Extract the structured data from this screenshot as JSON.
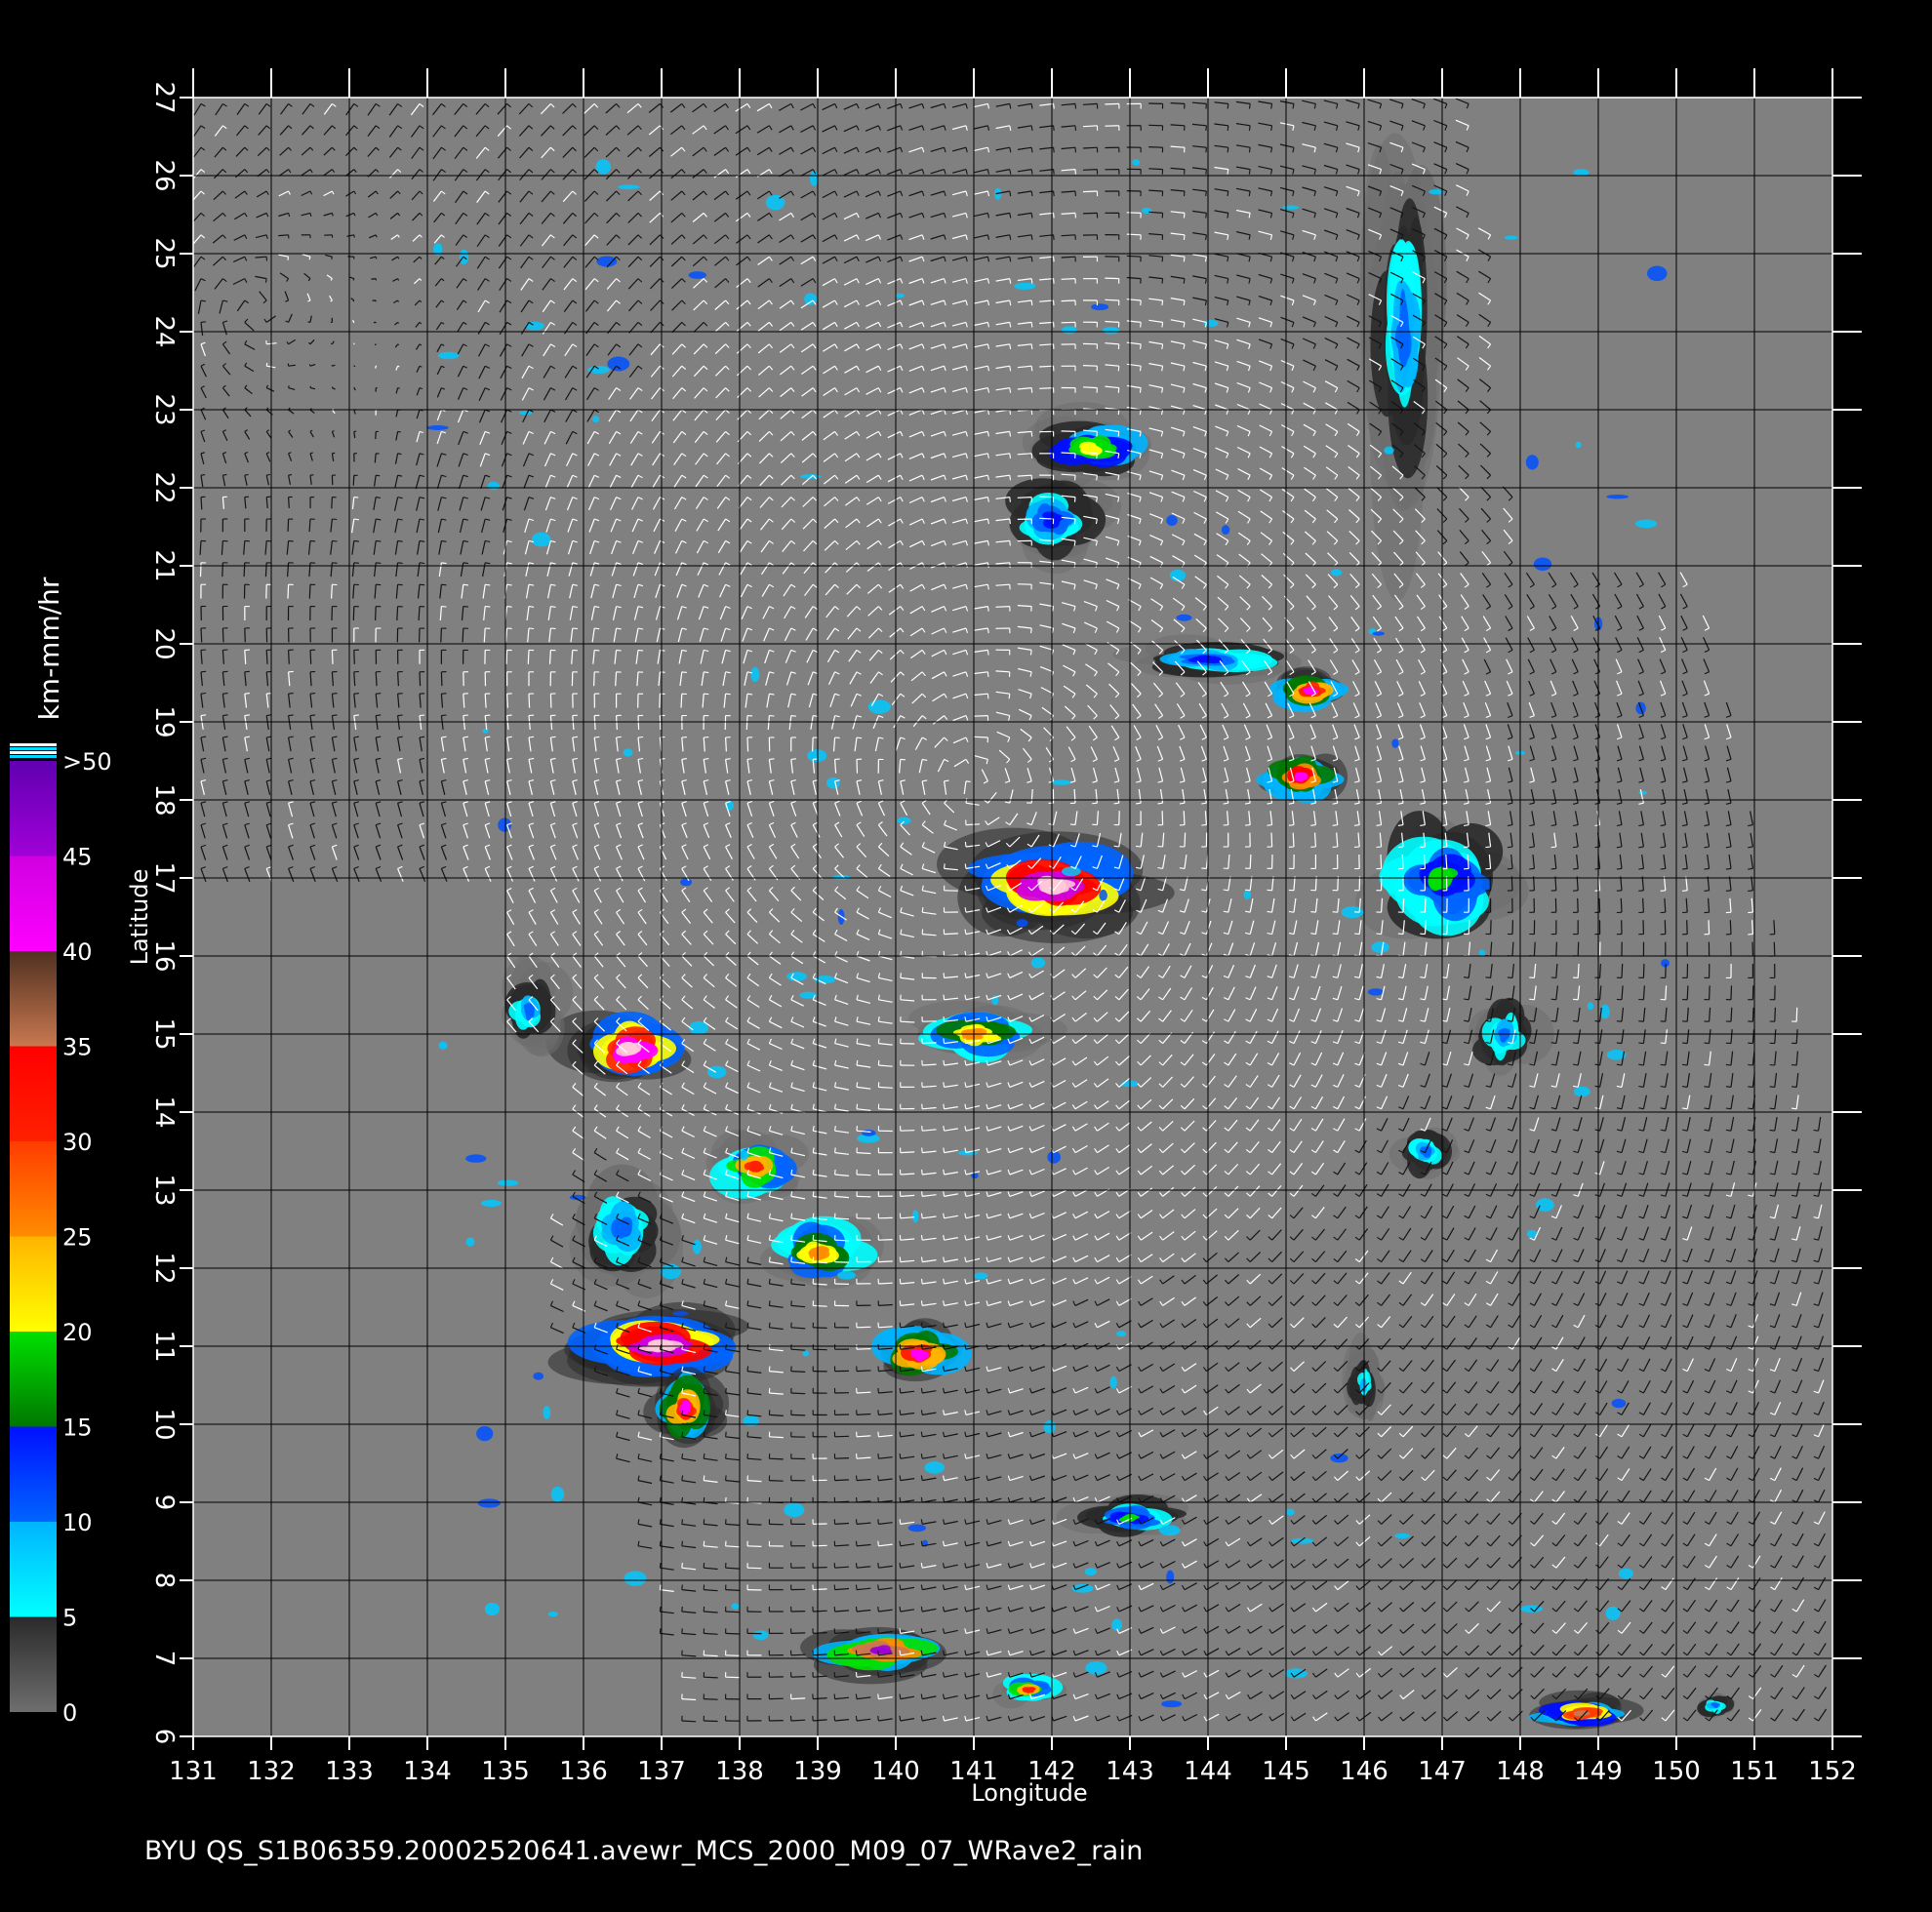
{
  "map": {
    "x_axis": {
      "label": "Longitude",
      "ticks": [
        "131",
        "132",
        "133",
        "134",
        "135",
        "136",
        "137",
        "138",
        "139",
        "140",
        "141",
        "142",
        "143",
        "144",
        "145",
        "146",
        "147",
        "148",
        "149",
        "150",
        "151",
        "152"
      ],
      "range": [
        131,
        152
      ]
    },
    "y_axis": {
      "label": "Latitude",
      "ticks": [
        "6",
        "7",
        "8",
        "9",
        "10",
        "11",
        "12",
        "13",
        "14",
        "15",
        "16",
        "17",
        "18",
        "19",
        "20",
        "21",
        "22",
        "23",
        "24",
        "25",
        "26",
        "27"
      ],
      "range": [
        6,
        27
      ]
    },
    "grid": true,
    "background_color": "#808080",
    "wind_vector_colors": {
      "light": "#ffffff",
      "dark": "#141414"
    },
    "cyclone_center": {
      "lon": 141.0,
      "lat": 18.2
    }
  },
  "colorbar": {
    "label": "km-mm/hr",
    "ticks": [
      "0",
      "5",
      "10",
      "15",
      "20",
      "25",
      "30",
      "35",
      "40",
      "45",
      ">50"
    ],
    "bands": [
      {
        "from": 0,
        "to": 5,
        "color_bottom": "#6e6e6e",
        "color_top": "#2a2a2a"
      },
      {
        "from": 5,
        "to": 10,
        "color_bottom": "#00ffff",
        "color_top": "#00b4ff"
      },
      {
        "from": 10,
        "to": 15,
        "color_bottom": "#0064ff",
        "color_top": "#0010ff"
      },
      {
        "from": 15,
        "to": 20,
        "color_bottom": "#007800",
        "color_top": "#00e000"
      },
      {
        "from": 20,
        "to": 25,
        "color_bottom": "#ffff00",
        "color_top": "#ffb400"
      },
      {
        "from": 25,
        "to": 30,
        "color_bottom": "#ff8c00",
        "color_top": "#ff3c00"
      },
      {
        "from": 30,
        "to": 35,
        "color_bottom": "#ff2000",
        "color_top": "#ff0000"
      },
      {
        "from": 35,
        "to": 40,
        "color_bottom": "#c87850",
        "color_top": "#503020"
      },
      {
        "from": 40,
        "to": 45,
        "color_bottom": "#ff00ff",
        "color_top": "#d000e0"
      },
      {
        "from": 45,
        "to": 50,
        "color_bottom": "#a000d8",
        "color_top": "#6000b0"
      }
    ],
    "overflow_colors": [
      "#ffffff",
      "#00d8ff",
      "#ffffff",
      "#00d8ff"
    ]
  },
  "rain_cells": [
    {
      "lon": 137.0,
      "lat": 11.0,
      "rx": 1.4,
      "ry": 0.55,
      "peak": 55
    },
    {
      "lon": 137.3,
      "lat": 10.2,
      "rx": 0.5,
      "ry": 0.6,
      "peak": 40
    },
    {
      "lon": 136.6,
      "lat": 14.8,
      "rx": 0.9,
      "ry": 0.55,
      "peak": 50
    },
    {
      "lon": 142.0,
      "lat": 16.9,
      "rx": 1.5,
      "ry": 0.7,
      "peak": 55
    },
    {
      "lon": 140.3,
      "lat": 10.9,
      "rx": 0.7,
      "ry": 0.45,
      "peak": 40
    },
    {
      "lon": 139.8,
      "lat": 7.1,
      "rx": 1.0,
      "ry": 0.35,
      "peak": 45
    },
    {
      "lon": 148.8,
      "lat": 6.3,
      "rx": 0.8,
      "ry": 0.25,
      "peak": 35
    },
    {
      "lon": 145.2,
      "lat": 18.3,
      "rx": 0.6,
      "ry": 0.4,
      "peak": 42
    },
    {
      "lon": 145.3,
      "lat": 19.4,
      "rx": 0.6,
      "ry": 0.3,
      "peak": 40
    },
    {
      "lon": 138.2,
      "lat": 13.3,
      "rx": 0.7,
      "ry": 0.5,
      "peak": 30
    },
    {
      "lon": 141.0,
      "lat": 15.0,
      "rx": 1.0,
      "ry": 0.4,
      "peak": 25
    },
    {
      "lon": 139.0,
      "lat": 12.2,
      "rx": 0.8,
      "ry": 0.5,
      "peak": 25
    },
    {
      "lon": 142.5,
      "lat": 22.5,
      "rx": 1.0,
      "ry": 0.5,
      "peak": 22
    },
    {
      "lon": 141.7,
      "lat": 6.6,
      "rx": 0.5,
      "ry": 0.25,
      "peak": 30
    },
    {
      "lon": 147.0,
      "lat": 17.0,
      "rx": 1.2,
      "ry": 1.0,
      "peak": 18
    },
    {
      "lon": 146.8,
      "lat": 13.5,
      "rx": 0.4,
      "ry": 0.4,
      "peak": 12
    },
    {
      "lon": 146.5,
      "lat": 24.0,
      "rx": 0.6,
      "ry": 2.8,
      "peak": 10
    },
    {
      "lon": 150.5,
      "lat": 6.4,
      "rx": 0.3,
      "ry": 0.2,
      "peak": 12
    },
    {
      "lon": 143.0,
      "lat": 8.8,
      "rx": 0.8,
      "ry": 0.3,
      "peak": 18
    },
    {
      "lon": 135.3,
      "lat": 15.3,
      "rx": 0.5,
      "ry": 0.6,
      "peak": 12
    },
    {
      "lon": 136.5,
      "lat": 12.5,
      "rx": 0.8,
      "ry": 0.9,
      "peak": 10
    },
    {
      "lon": 144.0,
      "lat": 19.8,
      "rx": 1.2,
      "ry": 0.3,
      "peak": 14
    },
    {
      "lon": 147.8,
      "lat": 15.0,
      "rx": 0.5,
      "ry": 0.6,
      "peak": 12
    },
    {
      "lon": 146.0,
      "lat": 10.5,
      "rx": 0.3,
      "ry": 0.6,
      "peak": 8
    },
    {
      "lon": 142.0,
      "lat": 21.6,
      "rx": 0.8,
      "ry": 0.6,
      "peak": 14
    }
  ],
  "footer": {
    "text": "BYU  QS_S1B06359.20002520641.avewr_MCS_2000_M09_07_WRave2_rain"
  }
}
